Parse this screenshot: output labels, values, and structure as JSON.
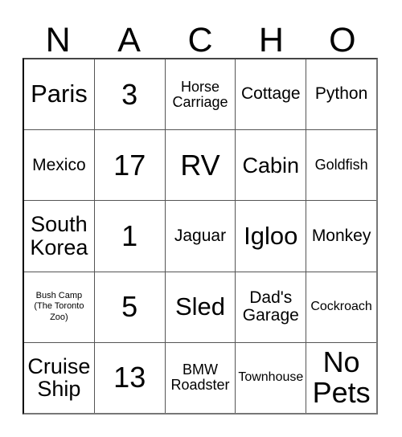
{
  "card": {
    "title": "NACHO",
    "header_letters": [
      "N",
      "A",
      "C",
      "H",
      "O"
    ],
    "rows": [
      [
        {
          "text": "Paris",
          "size": "fs-xl"
        },
        {
          "text": "3",
          "size": "fs-xxl"
        },
        {
          "text": "Horse\nCarriage",
          "size": "fs-sm"
        },
        {
          "text": "Cottage",
          "size": "fs-md"
        },
        {
          "text": "Python",
          "size": "fs-md"
        }
      ],
      [
        {
          "text": "Mexico",
          "size": "fs-md"
        },
        {
          "text": "17",
          "size": "fs-xxl"
        },
        {
          "text": "RV",
          "size": "fs-xxl"
        },
        {
          "text": "Cabin",
          "size": "fs-lg"
        },
        {
          "text": "Goldfish",
          "size": "fs-sm"
        }
      ],
      [
        {
          "text": "South\nKorea",
          "size": "fs-lg"
        },
        {
          "text": "1",
          "size": "fs-xxl"
        },
        {
          "text": "Jaguar",
          "size": "fs-md"
        },
        {
          "text": "Igloo",
          "size": "fs-xl"
        },
        {
          "text": "Monkey",
          "size": "fs-md"
        }
      ],
      [
        {
          "text": "Bush Camp\n(The Toronto\nZoo)",
          "size": "fs-xxs"
        },
        {
          "text": "5",
          "size": "fs-xxl"
        },
        {
          "text": "Sled",
          "size": "fs-xl"
        },
        {
          "text": "Dad's\nGarage",
          "size": "fs-md"
        },
        {
          "text": "Cockroach",
          "size": "fs-xs"
        }
      ],
      [
        {
          "text": "Cruise\nShip",
          "size": "fs-lg"
        },
        {
          "text": "13",
          "size": "fs-xxl"
        },
        {
          "text": "BMW\nRoadster",
          "size": "fs-sm"
        },
        {
          "text": "Townhouse",
          "size": "fs-xs"
        },
        {
          "text": "No\nPets",
          "size": "fs-xxl"
        }
      ]
    ]
  },
  "colors": {
    "background": "#ffffff",
    "text": "#000000",
    "grid_line": "#555555",
    "border": "#000000"
  }
}
